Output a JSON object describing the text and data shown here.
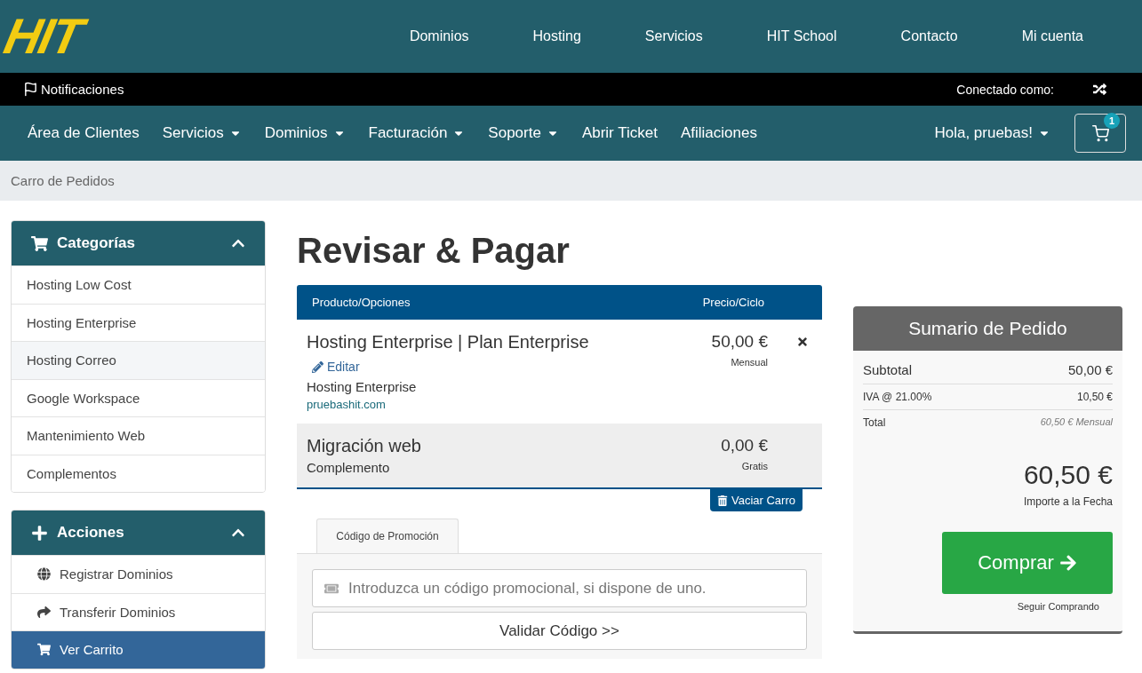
{
  "header": {
    "logo": "HIT",
    "links": [
      "Dominios",
      "Hosting",
      "Servicios",
      "HIT School",
      "Contacto",
      "Mi cuenta"
    ]
  },
  "topbar": {
    "notifications": "Notificaciones",
    "connected": "Conectado como:"
  },
  "nav": {
    "items": [
      {
        "label": "Área de Clientes",
        "dropdown": false
      },
      {
        "label": "Servicios",
        "dropdown": true
      },
      {
        "label": "Dominios",
        "dropdown": true
      },
      {
        "label": "Facturación",
        "dropdown": true
      },
      {
        "label": "Soporte",
        "dropdown": true
      },
      {
        "label": "Abrir Ticket",
        "dropdown": false
      },
      {
        "label": "Afiliaciones",
        "dropdown": false
      }
    ],
    "user": "Hola, pruebas!",
    "cart_count": "1"
  },
  "breadcrumb": "Carro de Pedidos",
  "sidebar": [
    {
      "title": "Categorías",
      "expanded": true,
      "items": [
        {
          "label": "Hosting Low Cost",
          "highlighted": false,
          "selected": false
        },
        {
          "label": "Hosting Enterprise",
          "highlighted": false,
          "selected": false
        },
        {
          "label": "Hosting Correo",
          "highlighted": true,
          "selected": false
        },
        {
          "label": "Google Workspace",
          "highlighted": false,
          "selected": false
        },
        {
          "label": "Mantenimiento Web",
          "highlighted": false,
          "selected": false
        },
        {
          "label": "Complementos",
          "highlighted": false,
          "selected": false
        }
      ]
    },
    {
      "title": "Acciones",
      "expanded": true,
      "items": [
        {
          "label": "Registrar Dominios",
          "highlighted": false,
          "selected": false
        },
        {
          "label": "Transferir Dominios",
          "highlighted": false,
          "selected": false
        },
        {
          "label": "Ver Carrito",
          "highlighted": false,
          "selected": true
        }
      ]
    }
  ],
  "page_title": "Revisar & Pagar",
  "cart": {
    "columns": [
      "Producto/Opciones",
      "Precio/Ciclo"
    ],
    "items": [
      {
        "kind": "product",
        "name": "Hosting Enterprise | Plan Enterprise",
        "edit": "Editar",
        "group": "Hosting Enterprise",
        "domain": "pruebashit.com",
        "price": "50,00 €",
        "cycle": "Mensual"
      },
      {
        "kind": "addon",
        "name": "Migración web",
        "group": "Complemento",
        "price": "0,00 €",
        "cycle": "Gratis"
      }
    ],
    "empty_button": "Vaciar Carro"
  },
  "promo": {
    "tab": "Código de Promoción",
    "placeholder": "Introduzca un código promocional, si dispone de uno.",
    "button": "Validar Código >>"
  },
  "summary": {
    "title": "Sumario de Pedido",
    "rows": [
      {
        "label": "Subtotal",
        "value": "50,00 €",
        "kind": "main"
      },
      {
        "label": "IVA @ 21.00%",
        "value": "10,50 €",
        "kind": "small"
      },
      {
        "label": "Total",
        "value": "60,50 € Mensual",
        "kind": "note"
      }
    ],
    "amount": "60,50 €",
    "amount_label": "Importe a la Fecha",
    "checkout": "Comprar",
    "continue": "Seguir Comprando"
  }
}
